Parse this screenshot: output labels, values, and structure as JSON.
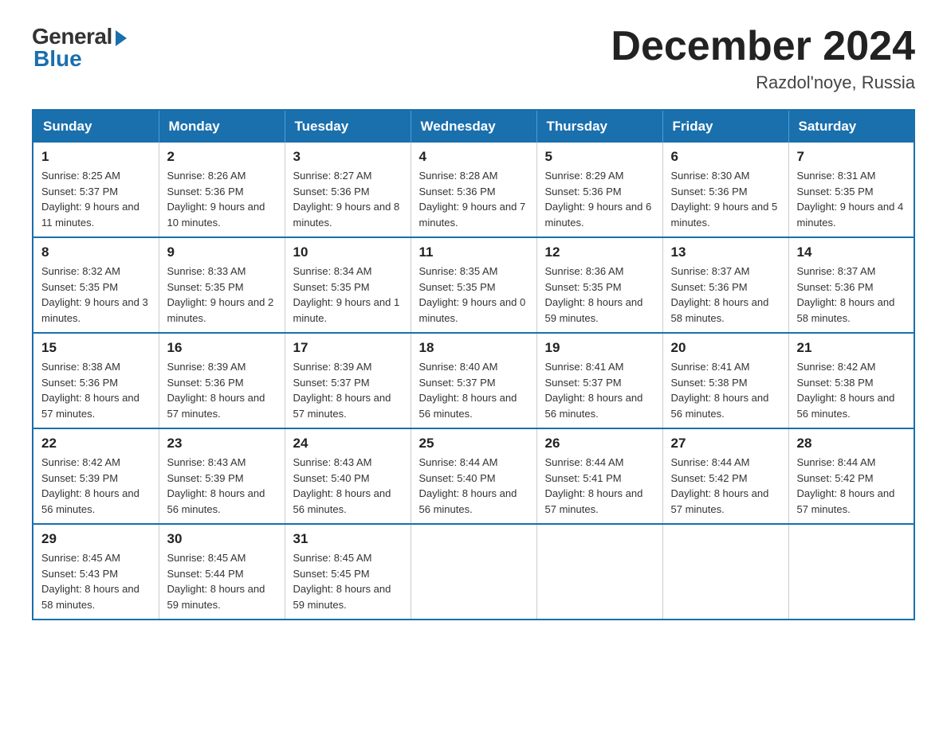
{
  "logo": {
    "general": "General",
    "blue": "Blue"
  },
  "title": {
    "month_year": "December 2024",
    "location": "Razdol'noye, Russia"
  },
  "weekdays": [
    "Sunday",
    "Monday",
    "Tuesday",
    "Wednesday",
    "Thursday",
    "Friday",
    "Saturday"
  ],
  "weeks": [
    [
      {
        "day": "1",
        "sunrise": "8:25 AM",
        "sunset": "5:37 PM",
        "daylight": "9 hours and 11 minutes."
      },
      {
        "day": "2",
        "sunrise": "8:26 AM",
        "sunset": "5:36 PM",
        "daylight": "9 hours and 10 minutes."
      },
      {
        "day": "3",
        "sunrise": "8:27 AM",
        "sunset": "5:36 PM",
        "daylight": "9 hours and 8 minutes."
      },
      {
        "day": "4",
        "sunrise": "8:28 AM",
        "sunset": "5:36 PM",
        "daylight": "9 hours and 7 minutes."
      },
      {
        "day": "5",
        "sunrise": "8:29 AM",
        "sunset": "5:36 PM",
        "daylight": "9 hours and 6 minutes."
      },
      {
        "day": "6",
        "sunrise": "8:30 AM",
        "sunset": "5:36 PM",
        "daylight": "9 hours and 5 minutes."
      },
      {
        "day": "7",
        "sunrise": "8:31 AM",
        "sunset": "5:35 PM",
        "daylight": "9 hours and 4 minutes."
      }
    ],
    [
      {
        "day": "8",
        "sunrise": "8:32 AM",
        "sunset": "5:35 PM",
        "daylight": "9 hours and 3 minutes."
      },
      {
        "day": "9",
        "sunrise": "8:33 AM",
        "sunset": "5:35 PM",
        "daylight": "9 hours and 2 minutes."
      },
      {
        "day": "10",
        "sunrise": "8:34 AM",
        "sunset": "5:35 PM",
        "daylight": "9 hours and 1 minute."
      },
      {
        "day": "11",
        "sunrise": "8:35 AM",
        "sunset": "5:35 PM",
        "daylight": "9 hours and 0 minutes."
      },
      {
        "day": "12",
        "sunrise": "8:36 AM",
        "sunset": "5:35 PM",
        "daylight": "8 hours and 59 minutes."
      },
      {
        "day": "13",
        "sunrise": "8:37 AM",
        "sunset": "5:36 PM",
        "daylight": "8 hours and 58 minutes."
      },
      {
        "day": "14",
        "sunrise": "8:37 AM",
        "sunset": "5:36 PM",
        "daylight": "8 hours and 58 minutes."
      }
    ],
    [
      {
        "day": "15",
        "sunrise": "8:38 AM",
        "sunset": "5:36 PM",
        "daylight": "8 hours and 57 minutes."
      },
      {
        "day": "16",
        "sunrise": "8:39 AM",
        "sunset": "5:36 PM",
        "daylight": "8 hours and 57 minutes."
      },
      {
        "day": "17",
        "sunrise": "8:39 AM",
        "sunset": "5:37 PM",
        "daylight": "8 hours and 57 minutes."
      },
      {
        "day": "18",
        "sunrise": "8:40 AM",
        "sunset": "5:37 PM",
        "daylight": "8 hours and 56 minutes."
      },
      {
        "day": "19",
        "sunrise": "8:41 AM",
        "sunset": "5:37 PM",
        "daylight": "8 hours and 56 minutes."
      },
      {
        "day": "20",
        "sunrise": "8:41 AM",
        "sunset": "5:38 PM",
        "daylight": "8 hours and 56 minutes."
      },
      {
        "day": "21",
        "sunrise": "8:42 AM",
        "sunset": "5:38 PM",
        "daylight": "8 hours and 56 minutes."
      }
    ],
    [
      {
        "day": "22",
        "sunrise": "8:42 AM",
        "sunset": "5:39 PM",
        "daylight": "8 hours and 56 minutes."
      },
      {
        "day": "23",
        "sunrise": "8:43 AM",
        "sunset": "5:39 PM",
        "daylight": "8 hours and 56 minutes."
      },
      {
        "day": "24",
        "sunrise": "8:43 AM",
        "sunset": "5:40 PM",
        "daylight": "8 hours and 56 minutes."
      },
      {
        "day": "25",
        "sunrise": "8:44 AM",
        "sunset": "5:40 PM",
        "daylight": "8 hours and 56 minutes."
      },
      {
        "day": "26",
        "sunrise": "8:44 AM",
        "sunset": "5:41 PM",
        "daylight": "8 hours and 57 minutes."
      },
      {
        "day": "27",
        "sunrise": "8:44 AM",
        "sunset": "5:42 PM",
        "daylight": "8 hours and 57 minutes."
      },
      {
        "day": "28",
        "sunrise": "8:44 AM",
        "sunset": "5:42 PM",
        "daylight": "8 hours and 57 minutes."
      }
    ],
    [
      {
        "day": "29",
        "sunrise": "8:45 AM",
        "sunset": "5:43 PM",
        "daylight": "8 hours and 58 minutes."
      },
      {
        "day": "30",
        "sunrise": "8:45 AM",
        "sunset": "5:44 PM",
        "daylight": "8 hours and 59 minutes."
      },
      {
        "day": "31",
        "sunrise": "8:45 AM",
        "sunset": "5:45 PM",
        "daylight": "8 hours and 59 minutes."
      },
      null,
      null,
      null,
      null
    ]
  ],
  "labels": {
    "sunrise": "Sunrise:",
    "sunset": "Sunset:",
    "daylight": "Daylight:"
  }
}
